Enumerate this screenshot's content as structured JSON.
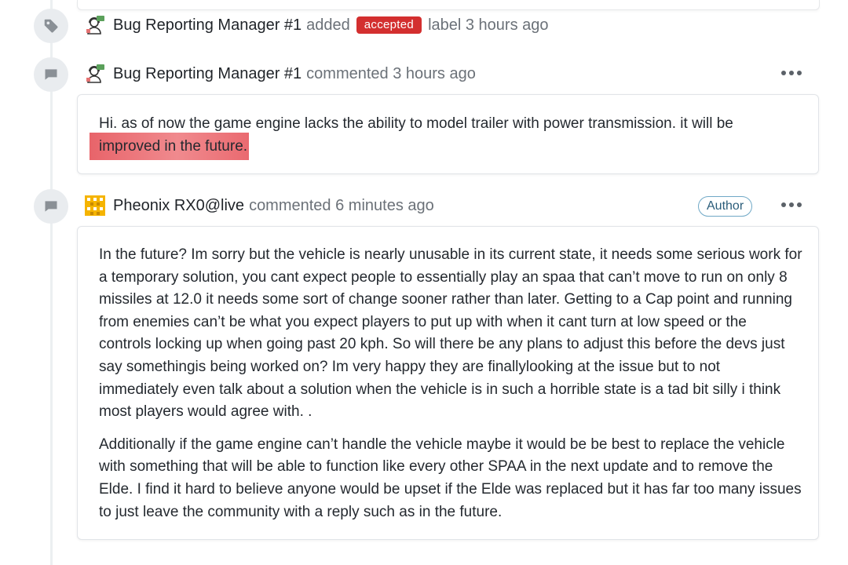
{
  "events": {
    "label_event": {
      "user": "Bug Reporting Manager #1",
      "action": "added",
      "label": "accepted",
      "suffix": "label 3 hours ago",
      "label_color": "#d32f2f",
      "icon": "tag-icon"
    },
    "comment1": {
      "user": "Bug Reporting Manager #1",
      "meta": "commented 3 hours ago",
      "icon": "comment-icon",
      "body_part1": "Hi. as of now the game engine lacks the ability to model trailer with power transmission. it will be",
      "body_highlight": "improved in the future."
    },
    "comment2": {
      "user": "Pheonix RX0@live",
      "meta": "commented 6 minutes ago",
      "badge": "Author",
      "icon": "comment-icon",
      "paragraph1": "In the future? Im sorry but the vehicle is nearly unusable in its current state, it needs some serious work for a temporary solution, you cant expect people to essentially play an spaa that can’t move to run on only 8 missiles at 12.0 it needs some sort of change sooner rather than later. Getting to a Cap point and running from enemies can’t be what you expect players to put up with when it cant turn at low speed or the controls locking up when going past 20 kph. So will there be any plans to adjust this before the devs just say somethingis being worked on? Im very happy they are finallylooking at the issue but to not immediately even talk about a solution when the vehicle is in such a horrible state is a tad bit silly i think most players would agree with. .",
      "paragraph2": "Additionally if the game engine can’t handle the vehicle maybe it would be be best to replace the vehicle with something that will be able to function like every other SPAA in the next update and to remove the Elde. I find it hard to believe anyone would be upset if the Elde was replaced but it has far too many issues to just leave the community with a reply such as in the future."
    }
  }
}
